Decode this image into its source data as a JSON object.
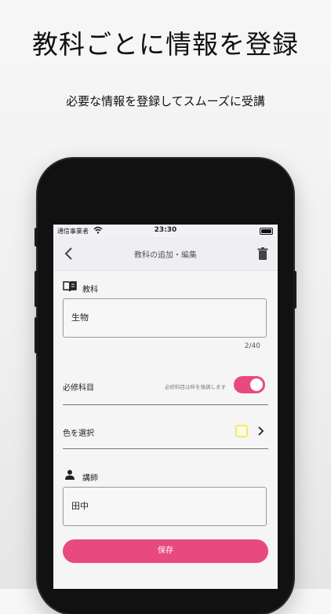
{
  "promo": {
    "headline": "教科ごとに情報を登録",
    "subline": "必要な情報を登録してスムーズに受講"
  },
  "status_bar": {
    "carrier": "通信事業者",
    "time": "23:30"
  },
  "nav": {
    "title": "教科の追加・編集"
  },
  "form": {
    "subject_label": "教科",
    "subject_value": "生物",
    "subject_counter": "2/40",
    "required_label": "必修科目",
    "required_hint": "必修科目は枠を強調します",
    "required_on": true,
    "color_label": "色を選択",
    "color_value": "#fdfbe3",
    "teacher_label": "講師",
    "teacher_value": "田中",
    "save_label": "保存"
  },
  "colors": {
    "accent": "#e84a7f",
    "swatch_border": "#f0f060"
  }
}
